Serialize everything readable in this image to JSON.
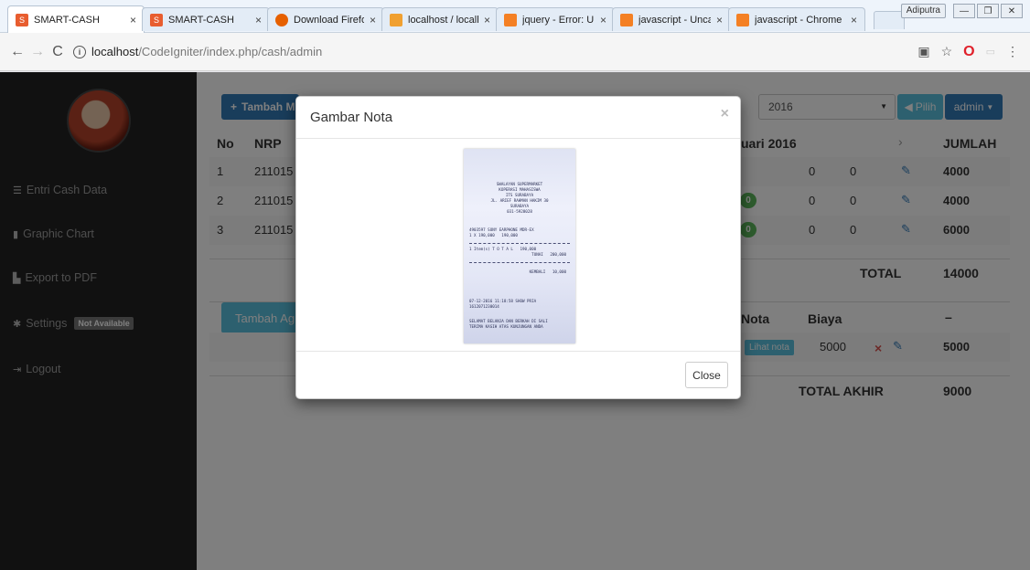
{
  "browser": {
    "tabs": [
      {
        "label": "SMART-CASH",
        "favicon": "smart-cash-icon",
        "active": true
      },
      {
        "label": "SMART-CASH",
        "favicon": "smart-cash-icon",
        "active": false
      },
      {
        "label": "Download Firefox —",
        "favicon": "firefox-icon",
        "active": false
      },
      {
        "label": "localhost / localhost",
        "favicon": "phpmyadmin-icon",
        "active": false
      },
      {
        "label": "jquery - Error: Uncau",
        "favicon": "stackoverflow-icon",
        "active": false
      },
      {
        "label": "javascript - Uncaugh",
        "favicon": "stackoverflow-icon",
        "active": false
      },
      {
        "label": "javascript - Chrome",
        "favicon": "stackoverflow-icon",
        "active": false
      }
    ],
    "user_badge": "Adiputra",
    "url_host": "localhost",
    "url_path": "/CodeIgniter/index.php/cash/admin",
    "opera_label": "O"
  },
  "sidebar": {
    "items": [
      {
        "label": "Entri Cash Data",
        "icon": "list-icon"
      },
      {
        "label": "Graphic Chart",
        "icon": "bar-chart-icon"
      },
      {
        "label": "Export to PDF",
        "icon": "file-icon"
      },
      {
        "label": "Settings",
        "icon": "gear-icon",
        "badge": "Not Available"
      },
      {
        "label": "Logout",
        "icon": "logout-icon"
      }
    ]
  },
  "toolbar": {
    "tambah_label": "Tambah M",
    "year": "2016",
    "pilih_label": "Pilih",
    "admin_label": "admin"
  },
  "table1": {
    "headers": {
      "no": "No",
      "nrp": "NRP",
      "month": "uari 2016",
      "nav": "›",
      "jumlah": "JUMLAH"
    },
    "rows": [
      {
        "no": "1",
        "nrp": "211015",
        "c1": "0",
        "c2": "0",
        "jumlah": "4000"
      },
      {
        "no": "2",
        "nrp": "211015",
        "badge": "0",
        "c1": "0",
        "c2": "0",
        "jumlah": "4000"
      },
      {
        "no": "3",
        "nrp": "211015",
        "badge": "0",
        "c1": "0",
        "c2": "0",
        "jumlah": "6000"
      }
    ],
    "total_label": "TOTAL",
    "total_value": "14000"
  },
  "table2": {
    "tambah_label": "Tambah Ag",
    "headers": {
      "nota": "Nota",
      "biaya": "Biaya",
      "dash": "–"
    },
    "rows": [
      {
        "nota_button": "Lihat nota",
        "biaya": "5000",
        "value": "5000"
      }
    ],
    "total_label": "TOTAL AKHIR",
    "total_value": "9000"
  },
  "modal": {
    "title": "Gambar Nota",
    "close_x": "×",
    "close_button": "Close",
    "receipt_lines": [
      "SWALAYAN SUPERMARKET",
      "KOPERASI MAHASISWA",
      "ITS SURABAYA",
      "JL. ARIEF RAHMAN HAKIM 30",
      "SURABAYA",
      "031-5928028",
      "4903597 SONY EARPHONE MDR-EX",
      "1 X 190,000   190,000",
      "1 Item(s) T O T A L   190,000",
      "TUNAI   200,000",
      "KEMBALI   10,000",
      "07-12-2016 11:18:58 SHOW PRIA",
      "1612071230014",
      "SELAMAT BELANJA DAN BERKAH DI SALI",
      "TERIMA KASIH ATAS KUNJUNGAN ANDA"
    ]
  }
}
